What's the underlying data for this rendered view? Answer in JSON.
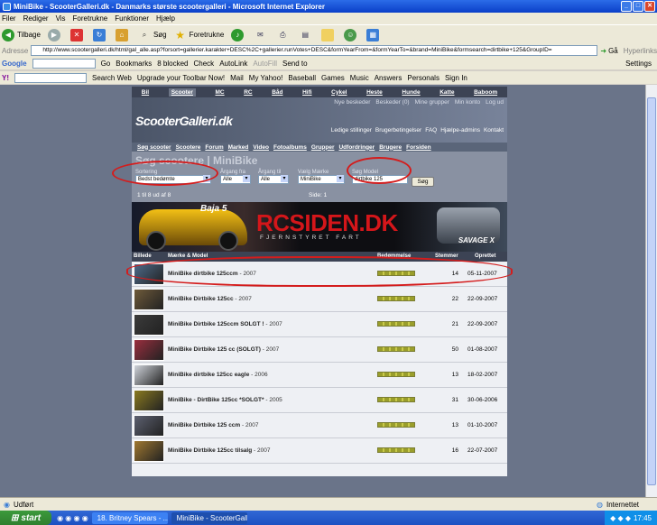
{
  "window": {
    "title": "MiniBike - ScooterGalleri.dk - Danmarks største scootergalleri - Microsoft Internet Explorer"
  },
  "menu": [
    "Filer",
    "Rediger",
    "Vis",
    "Foretrukne",
    "Funktioner",
    "Hjælp"
  ],
  "toolbar": {
    "back": "Tilbage",
    "search": "Søg",
    "favorites": "Foretrukne"
  },
  "address": {
    "label": "Adresse",
    "url": "http://www.scootergalleri.dk/html/gal_alle.asp?forsort=gallerier.karakter+DESC%2C+gallerier.runVotes+DESC&formYearFrom=&formYearTo=&brand=MiniBike&formsearch=dirtbike+125&GroupID=",
    "go": "Gå",
    "links": "Hyperlinks"
  },
  "googlebar": {
    "label": "Google",
    "go": "Go",
    "bookmarks": "Bookmarks",
    "blocked": "8 blocked",
    "check": "Check",
    "autolink": "AutoLink",
    "autofill": "AutoFill",
    "sendto": "Send to",
    "settings": "Settings"
  },
  "yahoobar": {
    "searchweb": "Search Web",
    "upgrade": "Upgrade your Toolbar Now!",
    "mail": "Mail",
    "myyahoo": "My Yahoo!",
    "baseball": "Baseball",
    "games": "Games",
    "music": "Music",
    "answers": "Answers",
    "personals": "Personals",
    "signin": "Sign In"
  },
  "site": {
    "categories": [
      "Bil",
      "Scooter",
      "MC",
      "RC",
      "Båd",
      "Hifi",
      "Cykel",
      "Heste",
      "Hunde",
      "Katte",
      "Baboom"
    ],
    "user_links": [
      "Nye beskeder",
      "Beskeder (0)",
      "Mine grupper",
      "Min konto",
      "Log ud"
    ],
    "logo": "ScooterGalleri.dk",
    "links2": [
      "Ledige stillinger",
      "Brugerbetingelser",
      "FAQ",
      "Hjælpe-admins",
      "Kontakt"
    ],
    "mainnav": [
      "Søg scooter",
      "Scootere",
      "Forum",
      "Marked",
      "Video",
      "Fotoalbums",
      "Grupper",
      "Udfordringer",
      "Brugere",
      "Forsiden"
    ],
    "page_title": "Søg scootere | MiniBike",
    "search": {
      "sort_label": "Sortering",
      "sort_value": "Bedst bedømte",
      "from_label": "Årgang fra",
      "from_value": "Alle",
      "to_label": "Årgang til",
      "to_value": "Alle",
      "brand_label": "Vælg Mærke",
      "brand_value": "MiniBike",
      "query_label": "Søg Model",
      "query_value": "dirtbike 125",
      "button": "Søg"
    },
    "pager": {
      "count": "1 til 8 ud af 8",
      "page": "Side: 1"
    },
    "banner": {
      "brand": "RCSIDEN.DK",
      "subtitle": "FJERNSTYRET FART",
      "car1_label": "Baja 5",
      "car2_label": "SAVAGE X"
    },
    "table": {
      "headers": [
        "Billede",
        "Mærke & Model",
        "Bedømmelse",
        "Stemmer",
        "Oprettet"
      ],
      "rows": [
        {
          "model": "MiniBike dirtbike 125ccm",
          "year": "- 2007",
          "votes": "14",
          "date": "05-11-2007",
          "rating": 0.6
        },
        {
          "model": "MiniBike Dirtbike 125cc",
          "year": "- 2007",
          "votes": "22",
          "date": "22-09-2007",
          "rating": 0.6
        },
        {
          "model": "MiniBike Dirtbike 125ccm SOLGT !",
          "year": "- 2007",
          "votes": "21",
          "date": "22-09-2007",
          "rating": 0.6
        },
        {
          "model": "MiniBike Dirtbike 125 cc (SOLGT)",
          "year": "- 2007",
          "votes": "50",
          "date": "01-08-2007",
          "rating": 0.6
        },
        {
          "model": "MiniBike dirtbike 125cc eagle",
          "year": "- 2006",
          "votes": "13",
          "date": "18-02-2007",
          "rating": 0.6
        },
        {
          "model": "MiniBike - DirtBike 125cc *SOLGT*",
          "year": "- 2005",
          "votes": "31",
          "date": "30-06-2006",
          "rating": 0.6
        },
        {
          "model": "MiniBike Dirtbike 125 ccm",
          "year": "- 2007",
          "votes": "13",
          "date": "01-10-2007",
          "rating": 0.6
        },
        {
          "model": "MiniBike Dirtbike 125cc tilsalg",
          "year": "- 2007",
          "votes": "16",
          "date": "22-07-2007",
          "rating": 0.6
        }
      ]
    }
  },
  "status": {
    "left": "Udført",
    "zone": "Internettet"
  },
  "taskbar": {
    "start": "start",
    "tasks": [
      "18. Britney Spears - ...",
      "MiniBike - ScooterGall..."
    ],
    "clock": "17:45"
  },
  "colors": {
    "annotation": "#d41c1c",
    "header_dark": "#3c4354"
  }
}
